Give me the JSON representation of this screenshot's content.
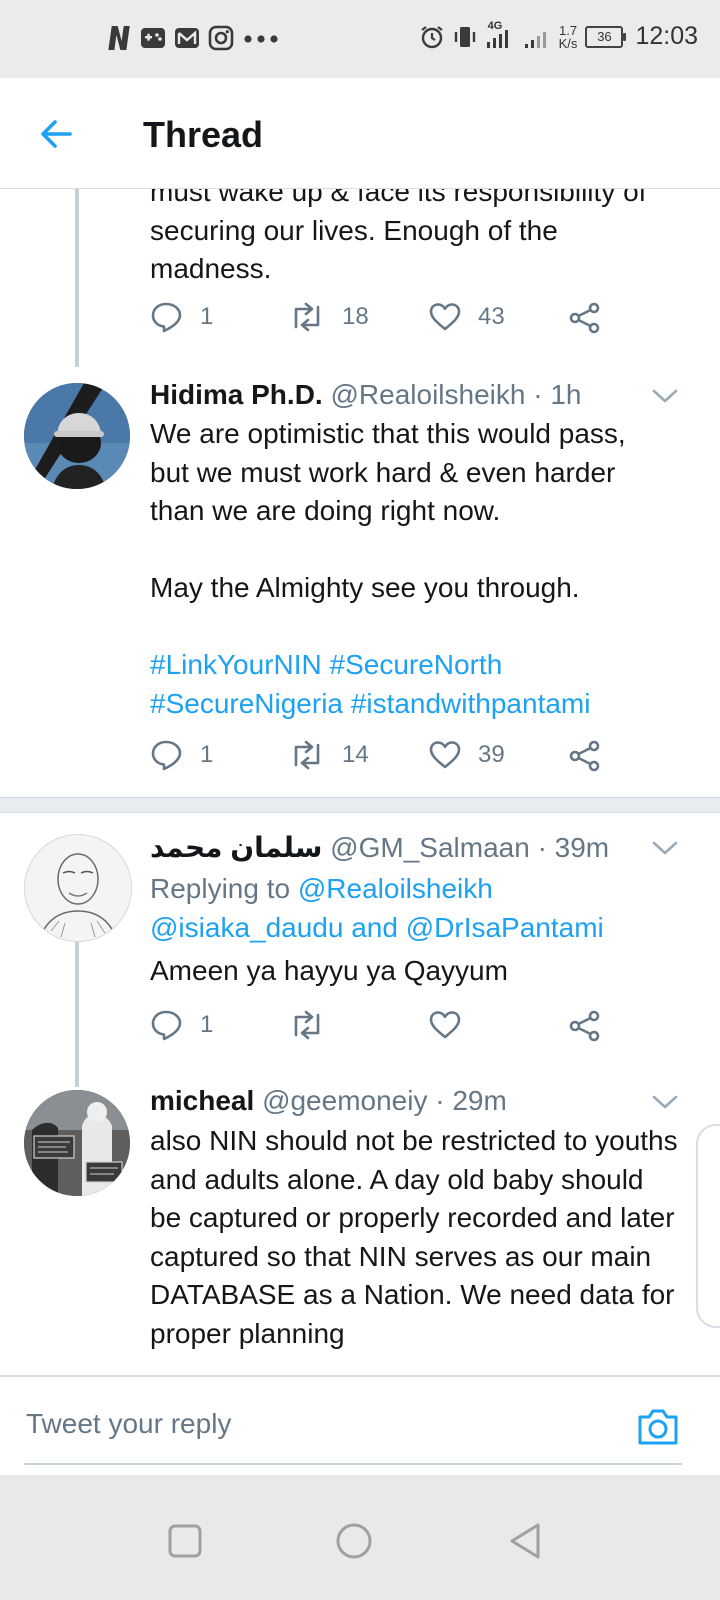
{
  "status_bar": {
    "time": "12:03",
    "network": "4G",
    "speed_value": "1.7",
    "speed_unit": "K/s",
    "battery": "36"
  },
  "header": {
    "title": "Thread"
  },
  "tweets": [
    {
      "text_lines": [
        "must wake up & face its responsibility of",
        "securing our lives. Enough of the",
        "madness."
      ],
      "reply_count": "1",
      "retweet_count": "18",
      "like_count": "43"
    },
    {
      "name": "Hidima Ph.D.",
      "handle": "@Realoilsheikh",
      "time": "· 1h",
      "text": "We are optimistic that this would pass, but we must work hard & even harder than we are doing right now.",
      "text2": "May the Almighty see you through.",
      "hashtags_line1": "#LinkYourNIN #SecureNorth",
      "hashtags_line2": "#SecureNigeria #istandwithpantami",
      "reply_count": "1",
      "retweet_count": "14",
      "like_count": "39"
    },
    {
      "name": "سلمان محمد",
      "handle": "@GM_Salmaan",
      "time": "· 39m",
      "replying_prefix": "Replying to",
      "replying_to_1": "@Realoilsheikh",
      "replying_to_2": "@isiaka_daudu",
      "replying_and": "and",
      "replying_to_3": "@DrIsaPantami",
      "text": "Ameen ya hayyu ya Qayyum",
      "reply_count": "1",
      "retweet_count": "",
      "like_count": ""
    },
    {
      "name": "micheal",
      "handle": "@geemoneiy",
      "time": "· 29m",
      "text": "also NIN should not be restricted to youths and adults alone. A day old baby should be captured or properly recorded and later captured so that NIN serves as our main DATABASE as a Nation. We need data for proper planning"
    }
  ],
  "reply_bar": {
    "placeholder": "Tweet your reply"
  },
  "colors": {
    "accent": "#1da1f2",
    "muted": "#657786",
    "text": "#14171a"
  }
}
